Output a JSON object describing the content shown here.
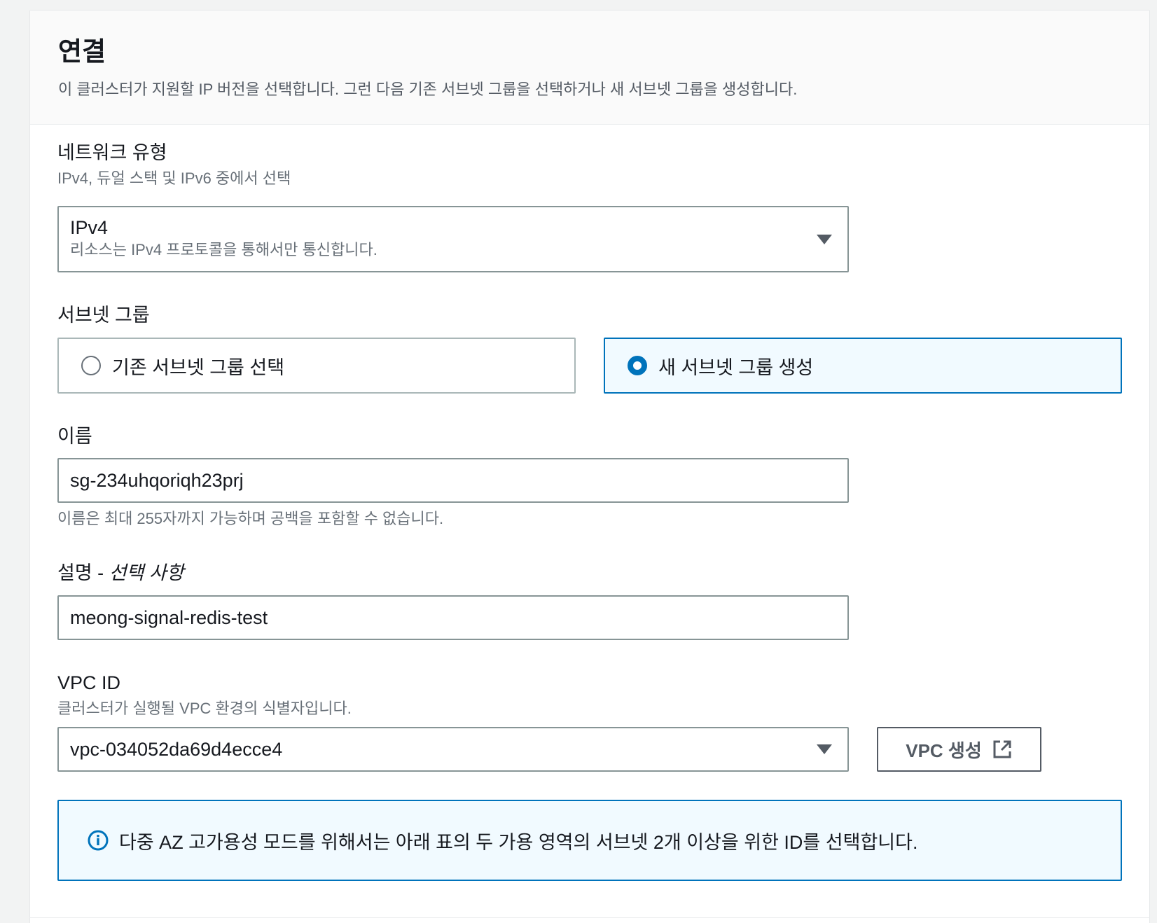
{
  "section": {
    "title": "연결",
    "description": "이 클러스터가 지원할 IP 버전을 선택합니다. 그런 다음 기존 서브넷 그룹을 선택하거나 새 서브넷 그룹을 생성합니다."
  },
  "network_type": {
    "label": "네트워크 유형",
    "hint": "IPv4, 듀얼 스택 및 IPv6 중에서 선택",
    "selected_value": "IPv4",
    "selected_description": "리소스는 IPv4 프로토콜을 통해서만 통신합니다."
  },
  "subnet_group": {
    "label": "서브넷 그룹",
    "options": [
      {
        "label": "기존 서브넷 그룹 선택",
        "selected": false
      },
      {
        "label": "새 서브넷 그룹 생성",
        "selected": true
      }
    ]
  },
  "name": {
    "label": "이름",
    "value": "sg-234uhqoriqh23prj",
    "hint": "이름은 최대 255자까지 가능하며 공백을 포함할 수 없습니다."
  },
  "description_field": {
    "label": "설명 - ",
    "optional": "선택 사항",
    "value": "meong-signal-redis-test"
  },
  "vpc": {
    "label": "VPC ID",
    "hint": "클러스터가 실행될 VPC 환경의 식별자입니다.",
    "selected_value": "vpc-034052da69d4ecce4",
    "create_button_label": "VPC 생성",
    "create_button_icon": "external-link-icon"
  },
  "info_alert": {
    "icon": "info-icon",
    "text": "다중 AZ 고가용성 모드를 위해서는 아래 표의 두 가용 영역의 서브넷 2개 이상을 위한 ID를 선택합니다."
  },
  "colors": {
    "accent": "#0073bb",
    "selected_bg": "#f1faff"
  }
}
